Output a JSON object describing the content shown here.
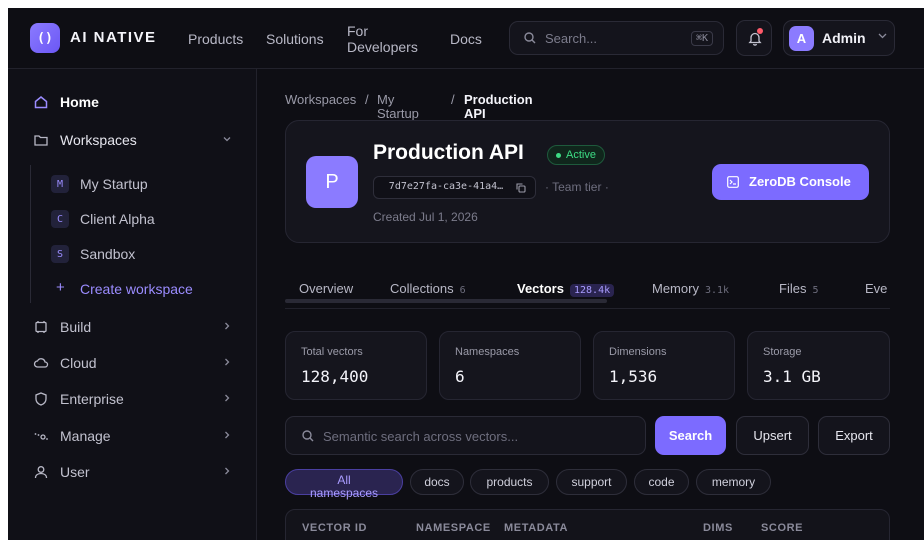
{
  "brand": {
    "name": "AI NATIVE",
    "logo_glyph": "()"
  },
  "topnav": {
    "links": [
      "Products",
      "Solutions",
      "For Developers",
      "Docs"
    ],
    "search_placeholder": "Search...",
    "search_shortcut": "⌘K",
    "user": {
      "initial": "A",
      "name": "Admin"
    }
  },
  "sidebar": {
    "home": "Home",
    "workspaces": "Workspaces",
    "workspace_items": [
      {
        "badge": "M",
        "label": "My Startup"
      },
      {
        "badge": "C",
        "label": "Client Alpha"
      },
      {
        "badge": "S",
        "label": "Sandbox"
      }
    ],
    "create_workspace": "Create workspace",
    "sections": [
      "Build",
      "Cloud",
      "Enterprise",
      "Manage",
      "User"
    ]
  },
  "breadcrumb": {
    "items": [
      "Workspaces",
      "My Startup",
      "Production API"
    ]
  },
  "project": {
    "initial": "P",
    "title": "Production API",
    "status": "Active",
    "id": "7d7e27fa-ca3e-41a4…",
    "tier": "Team tier",
    "created": "Created Jul 1, 2026",
    "console_label": "ZeroDB Console"
  },
  "tabs": [
    {
      "label": "Overview",
      "count": ""
    },
    {
      "label": "Collections",
      "count": "6"
    },
    {
      "label": "Vectors",
      "count": "128.4k"
    },
    {
      "label": "Memory",
      "count": "3.1k"
    },
    {
      "label": "Files",
      "count": "5"
    },
    {
      "label": "Eve",
      "count": ""
    }
  ],
  "stats": [
    {
      "label": "Total vectors",
      "value": "128,400"
    },
    {
      "label": "Namespaces",
      "value": "6"
    },
    {
      "label": "Dimensions",
      "value": "1,536"
    },
    {
      "label": "Storage",
      "value": "3.1 GB"
    }
  ],
  "vector_search": {
    "placeholder": "Semantic search across vectors...",
    "search_label": "Search",
    "upsert_label": "Upsert",
    "export_label": "Export"
  },
  "namespaces": [
    "All namespaces",
    "docs",
    "products",
    "support",
    "code",
    "memory"
  ],
  "table": {
    "columns": [
      "VECTOR ID",
      "NAMESPACE",
      "METADATA",
      "DIMS",
      "SCORE"
    ]
  },
  "colors": {
    "accent": "#7c6bff",
    "success": "#3ddc84",
    "background": "#0e0e14"
  }
}
